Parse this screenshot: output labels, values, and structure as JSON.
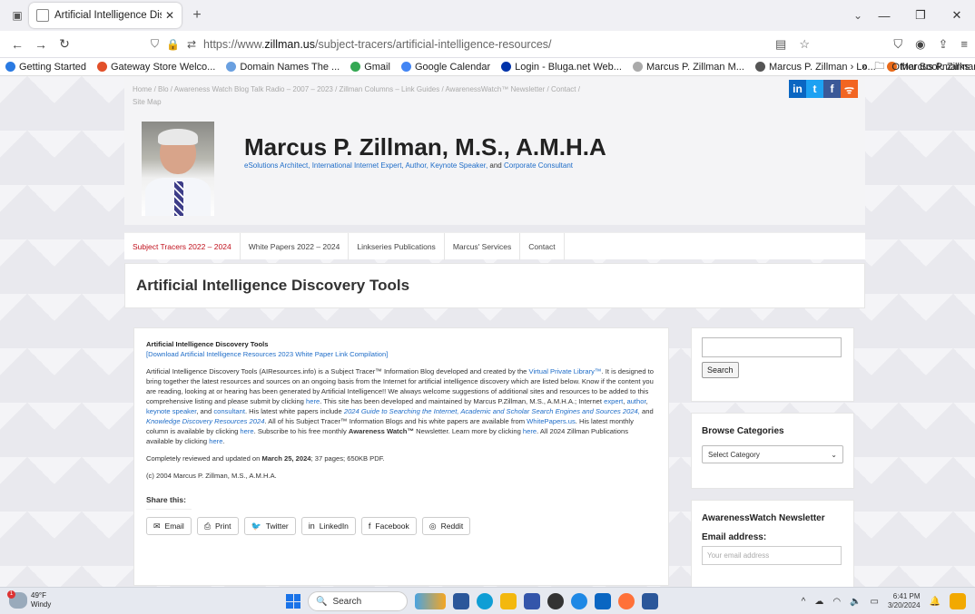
{
  "browser": {
    "tab_title": "Artificial Intelligence Discovery Tool",
    "url_prefix": "https://www.",
    "url_domain": "zillman.us",
    "url_path": "/subject-tracers/artificial-intelligence-resources/",
    "bookmarks": [
      {
        "label": "Getting Started",
        "color": "#2a7ae2"
      },
      {
        "label": "Gateway Store Welco...",
        "color": "#e2502a"
      },
      {
        "label": "Domain Names The ...",
        "color": "#6aa0e0"
      },
      {
        "label": "Gmail",
        "color": "#34a853"
      },
      {
        "label": "Google Calendar",
        "color": "#4285f4"
      },
      {
        "label": "Login - Bluga.net Web...",
        "color": "#0033aa"
      },
      {
        "label": "Marcus P. Zillman  M...",
        "color": "#aaaaaa"
      },
      {
        "label": "Marcus P. Zillman › Lo...",
        "color": "#555555"
      },
      {
        "label": "Marcus P. Zillman, M.S...",
        "color": "#e86a1a"
      }
    ],
    "other_bookmarks": "Other Bookmarks"
  },
  "site": {
    "breadcrumbs_line1": "Home  /  Blo  /  Awareness Watch Blog Talk Radio – 2007 – 2023  /  Zillman Columns – Link Guides  /  AwarenessWatch™ Newsletter  /  Contact  /",
    "breadcrumbs_line2": "Site Map",
    "social": [
      {
        "label": "in",
        "color": "#0a66c2",
        "icon": "linkedin-icon"
      },
      {
        "label": "t",
        "color": "#1da1f2",
        "icon": "twitter-icon"
      },
      {
        "label": "f",
        "color": "#3b5998",
        "icon": "facebook-icon"
      },
      {
        "label": "ᯤ",
        "color": "#f26522",
        "icon": "rss-icon"
      }
    ],
    "title": "Marcus P. Zillman, M.S., A.M.H.A",
    "tagline_part1": "eSolutions Architect, International Internet Expert, Author, Keynote Speaker,",
    "tagline_and": " and ",
    "tagline_part2": "Corporate Consultant",
    "menu": [
      {
        "label": "Subject Tracers 2022 – 2024",
        "active": true
      },
      {
        "label": "White Papers 2022 – 2024",
        "active": false
      },
      {
        "label": "Linkseries Publications",
        "active": false
      },
      {
        "label": "Marcus' Services",
        "active": false
      },
      {
        "label": "Contact",
        "active": false
      }
    ],
    "page_title": "Artificial Intelligence Discovery Tools"
  },
  "content": {
    "heading": "Artificial Intelligence Discovery Tools",
    "download_link": "[Download Artificial Intelligence Resources 2023 White Paper Link Compilation]",
    "p1_a": "Artificial Intelligence Discovery Tools (AIResources.info) is a Subject Tracer™ Information Blog developed and created by the ",
    "p1_link1": "Virtual Private Library™",
    "p1_b": ". It is designed to bring together the latest resources and sources on an ongoing basis from the Internet for artificial intelligence discovery which are listed below. Know if the content you are reading, looking at or hearing has been generated by Artificial Intelligence!! We always welcome suggestions of additional sites and resources to be added to this comprehensive listing and please submit by clicking ",
    "p1_here1": "here",
    "p1_c": ". This site has been developed and maintained by Marcus P.Zillman, M.S., A.M.H.A.; Internet ",
    "p1_expert": "expert",
    "p1_author": "author",
    "p1_keynote": "keynote speaker",
    "p1_and": ", and ",
    "p1_consultant": "consultant",
    "p1_d": ". His latest white papers include ",
    "p1_wp1": "2024 Guide to Searching the Internet,  Academic and Scholar Search Engines and Sources 2024,",
    "p1_e": " and ",
    "p1_wp2": "Knowledge Discovery Resources 2024",
    "p1_f": ". All of his Subject Tracer™ Information Blogs and his white papers are available from ",
    "p1_wpus": "WhitePapers.us",
    "p1_g": ". His latest monthly column is available by clicking ",
    "p1_here2": "here",
    "p1_h": ". Subscribe to his free monthly ",
    "p1_aw": "Awareness Watch™",
    "p1_i": " Newsletter. Learn more by clicking ",
    "p1_here3": "here",
    "p1_j": ". All 2024 Zillman Publications available by clicking ",
    "p1_here4": "here",
    "p1_k": ".",
    "p2_a": "Completely reviewed and updated on ",
    "p2_date": "March 25, 2024",
    "p2_b": "; 37 pages; 650KB PDF.",
    "copyright": "(c) 2004 Marcus P. Zillman, M.S., A.M.H.A.",
    "share_title": "Share this:",
    "share": [
      {
        "label": "Email",
        "icon": "email-icon",
        "glyph": "✉"
      },
      {
        "label": "Print",
        "icon": "print-icon",
        "glyph": "⎙"
      },
      {
        "label": "Twitter",
        "icon": "twitter-icon",
        "glyph": "🐦"
      },
      {
        "label": "LinkedIn",
        "icon": "linkedin-icon",
        "glyph": "in"
      },
      {
        "label": "Facebook",
        "icon": "facebook-icon",
        "glyph": "f"
      },
      {
        "label": "Reddit",
        "icon": "reddit-icon",
        "glyph": "◎"
      }
    ]
  },
  "sidebar": {
    "search_button": "Search",
    "categories_title": "Browse Categories",
    "categories_select": "Select Category",
    "newsletter_title": "AwarenessWatch Newsletter",
    "email_label": "Email address:",
    "email_placeholder": "Your email address"
  },
  "taskbar": {
    "temp": "49°F",
    "weather": "Windy",
    "badge": "1",
    "search": "Search",
    "time": "6:41 PM",
    "date": "3/20/2024"
  }
}
